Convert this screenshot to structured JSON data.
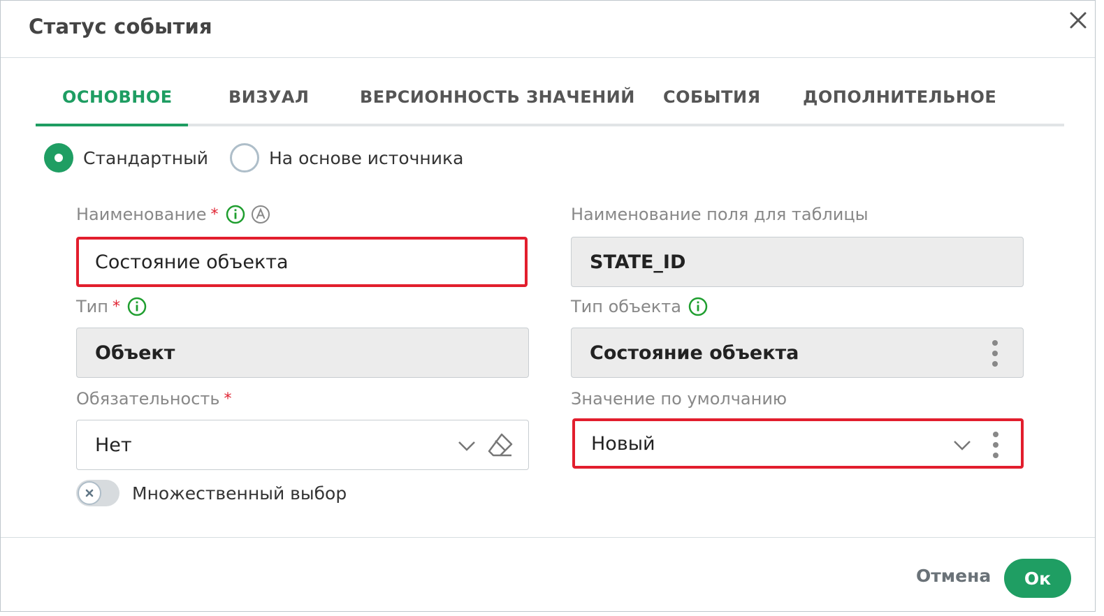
{
  "dialog": {
    "title": "Статус события",
    "close_icon": "close-icon"
  },
  "tabs": [
    {
      "label": "ОСНОВНОЕ",
      "active": true
    },
    {
      "label": "ВИЗУАЛ",
      "active": false
    },
    {
      "label": "ВЕРСИОННОСТЬ ЗНАЧЕНИЙ",
      "active": false
    },
    {
      "label": "СОБЫТИЯ",
      "active": false
    },
    {
      "label": "ДОПОЛНИТЕЛЬНОЕ",
      "active": false
    }
  ],
  "mode": {
    "options": [
      {
        "label": "Стандартный",
        "checked": true
      },
      {
        "label": "На основе источника",
        "checked": false
      }
    ]
  },
  "form": {
    "name": {
      "label": "Наименование",
      "required_mark": "*",
      "value": "Состояние объекта"
    },
    "table_field_name": {
      "label": "Наименование поля для таблицы",
      "value": "STATE_ID"
    },
    "type": {
      "label": "Тип",
      "required_mark": "*",
      "value": "Объект"
    },
    "object_type": {
      "label": "Тип объекта",
      "value": "Состояние объекта"
    },
    "obligation": {
      "label": "Обязательность",
      "required_mark": "*",
      "value": "Нет"
    },
    "default_value": {
      "label": "Значение по умолчанию",
      "value": "Новый"
    },
    "multiple_choice": {
      "label": "Множественный выбор",
      "enabled": false
    }
  },
  "footer": {
    "cancel_label": "Отмена",
    "ok_label": "Ок"
  },
  "colors": {
    "accent": "#1f9e63",
    "highlight": "#e21e2d",
    "required": "#e02433"
  }
}
